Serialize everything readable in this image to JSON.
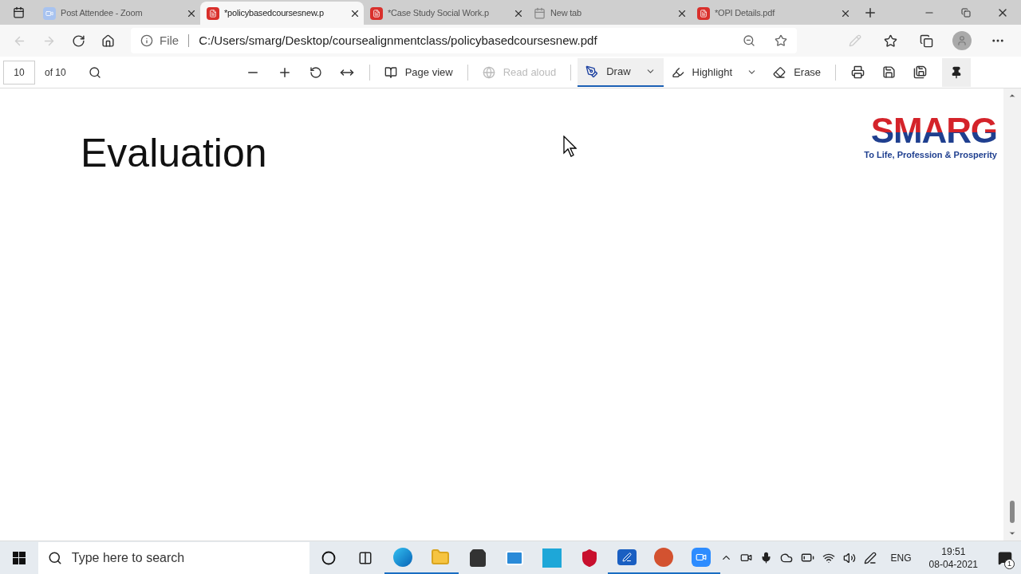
{
  "tabs": [
    {
      "kind": "zoom",
      "label": "Post Attendee - Zoom",
      "selected": false
    },
    {
      "kind": "pdf",
      "label": "*policybasedcoursesnew.p",
      "selected": true
    },
    {
      "kind": "pdf",
      "label": "*Case Study Social Work.p",
      "selected": false
    },
    {
      "kind": "newtab",
      "label": "New tab",
      "selected": false
    },
    {
      "kind": "pdf",
      "label": "*OPI Details.pdf",
      "selected": false
    }
  ],
  "address_bar": {
    "scheme": "File",
    "url": "C:/Users/smarg/Desktop/coursealignmentclass/policybasedcoursesnew.pdf"
  },
  "pdf_toolbar": {
    "page": "10",
    "page_total": "of 10",
    "tools": [
      {
        "kind": "pageview",
        "label": "Page view",
        "disabled": false,
        "selected": false
      },
      {
        "kind": "readaloud",
        "label": "Read aloud",
        "disabled": true,
        "selected": false
      },
      {
        "kind": "draw",
        "label": "Draw",
        "disabled": false,
        "selected": true
      },
      {
        "kind": "highlight",
        "label": "Highlight",
        "disabled": false,
        "selected": false
      },
      {
        "kind": "erase",
        "label": "Erase",
        "disabled": false,
        "selected": false
      }
    ]
  },
  "document": {
    "heading": "Evaluation",
    "logo": {
      "name": "SMARG",
      "tagline": "To Life, Profession & Prosperity"
    }
  },
  "taskbar": {
    "search_placeholder": "Type here to search",
    "apps": [
      {
        "kind": "cortana",
        "running": false
      },
      {
        "kind": "taskview",
        "running": false
      },
      {
        "kind": "edge",
        "running": true
      },
      {
        "kind": "explorer",
        "running": true
      },
      {
        "kind": "store",
        "running": false
      },
      {
        "kind": "mail",
        "running": false
      },
      {
        "kind": "launcher",
        "running": false
      },
      {
        "kind": "shield",
        "running": false
      },
      {
        "kind": "whiteboard",
        "running": true
      },
      {
        "kind": "powerpoint",
        "running": true
      },
      {
        "kind": "zoom",
        "running": true
      }
    ],
    "language": "ENG",
    "time": "19:51",
    "date": "08-04-2021",
    "notifications": "1"
  }
}
